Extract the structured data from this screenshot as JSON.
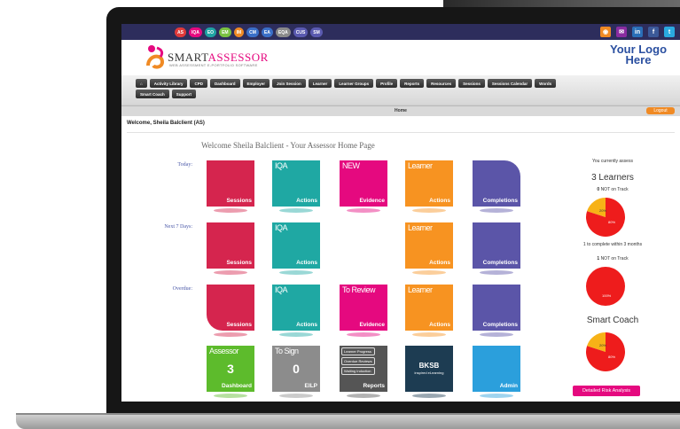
{
  "topbar": {
    "roles": [
      {
        "label": "AS",
        "color": "#e03a3a"
      },
      {
        "label": "IQA",
        "color": "#e5097f"
      },
      {
        "label": "EO",
        "color": "#1fa3a3"
      },
      {
        "label": "EM",
        "color": "#7ac142"
      },
      {
        "label": "IM",
        "color": "#f08a24"
      },
      {
        "label": "CM",
        "color": "#3a6fc8"
      },
      {
        "label": "EA",
        "color": "#3a6fc8"
      },
      {
        "label": "EQA",
        "color": "#8a8a8a"
      },
      {
        "label": "CUS",
        "color": "#5a5ab0"
      },
      {
        "label": "SM",
        "color": "#5a5ab0"
      }
    ],
    "social": [
      {
        "icon": "rss-icon",
        "glyph": "◉",
        "color": "#f08a24"
      },
      {
        "icon": "email-icon",
        "glyph": "✉",
        "color": "#8a2ca0"
      },
      {
        "icon": "linkedin-icon",
        "glyph": "in",
        "color": "#2a6fb8"
      },
      {
        "icon": "facebook-icon",
        "glyph": "f",
        "color": "#3b5998"
      },
      {
        "icon": "twitter-icon",
        "glyph": "t",
        "color": "#2aa9e0"
      }
    ]
  },
  "header": {
    "brand": "SMART",
    "brand_accent": "ASSESSOR",
    "brand_sub": "WEB ASSESSMENT E-PORTFOLIO SOFTWARE",
    "your_logo": "Your Logo Here"
  },
  "nav": {
    "home_icon": "home-icon",
    "row1": [
      "Activity Library",
      "CPD",
      "Dashboard",
      "Employer",
      "Join Session",
      "Learner",
      "Learner Groups",
      "Profile",
      "Reports",
      "Resources",
      "Sessions",
      "Sessions Calendar",
      "Words"
    ],
    "row2": [
      "Smart Coach",
      "Support"
    ]
  },
  "breadcrumb": "Home",
  "logout_label": "Logout",
  "welcome_text": "Welcome, Sheila Balclient (AS)",
  "home_title": "Welcome Sheila Balclient - Your Assessor Home Page",
  "rows": {
    "today": "Today:",
    "next7": "Next 7 Days:",
    "overdue": "Overdue:"
  },
  "tiles": {
    "sessions": "Sessions",
    "iqa_top": "IQA",
    "iqa_bot": "Actions",
    "new_top": "NEW",
    "evidence": "Evidence",
    "learner_top": "Learner",
    "learner_bot": "Actions",
    "completions": "Completions",
    "toreview_top": "To Review",
    "assessor_top": "Assessor",
    "assessor_num": "3",
    "assessor_bot": "Dashboard",
    "tosign_top": "To Sign",
    "tosign_num": "0",
    "tosign_bot": "EILP",
    "reports_items": [
      "Learner Progress",
      "Overdue Reviews",
      "Waiting Induction"
    ],
    "reports_bot": "Reports",
    "bksb_title": "BKSB",
    "bksb_sub": "inspired eLearning",
    "admin": "Admin"
  },
  "colors": {
    "sessions": "#d5254e",
    "iqa": "#1fa8a3",
    "evidence": "#e5097f",
    "learner": "#f79321",
    "completions": "#5b55a8",
    "assessor": "#5dbb2c",
    "tosign": "#8c8c8c",
    "reports": "#555555",
    "bksb": "#1d3c52",
    "admin": "#2b9fdc",
    "pie_red": "#ee1c1c",
    "pie_orange": "#f7b217"
  },
  "side": {
    "assess_label": "You currently assess",
    "learners": "3 Learners",
    "not_on_track_prefix": "0",
    "not_on_track_text": "NOT on Track",
    "pie1": {
      "orange": 20,
      "red": 80,
      "orange_label": "20%",
      "red_label": "80%"
    },
    "within_label": "1 to complete within 3 months",
    "not_on_track2_prefix": "1",
    "not_on_track2_text": "NOT on Track",
    "pie2": {
      "orange": 0,
      "red": 100,
      "red_label": "100%"
    },
    "smart_coach": "Smart Coach",
    "pie3": {
      "orange": 20,
      "red": 80,
      "orange_label": "20%",
      "red_label": "80%"
    },
    "risk_button": "Detailed Risk Analysis"
  }
}
